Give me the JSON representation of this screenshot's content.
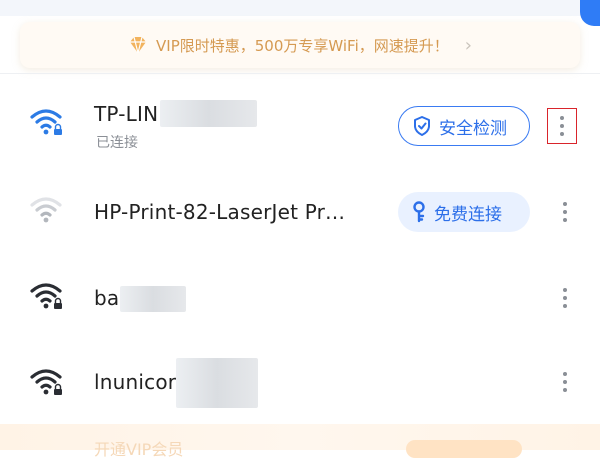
{
  "vip_banner": {
    "text": "VIP限时特惠，500万专享WiFi，网速提升！",
    "gem_icon": "vip-diamond-icon",
    "chevron": "›"
  },
  "colors": {
    "accent": "#2f7cf6",
    "vip_text": "#d59a52",
    "highlight": "#d9242b"
  },
  "networks": [
    {
      "ssid": "TP-LIN",
      "status": "已连接",
      "button_label": "安全检测",
      "button_icon": "shield-check-icon",
      "locked": true,
      "signal": "full",
      "connected": true
    },
    {
      "ssid": "HP-Print-82-LaserJet Pr…",
      "status": "",
      "button_label": "免费连接",
      "button_icon": "key-icon",
      "locked": false,
      "signal": "weak",
      "connected": false
    },
    {
      "ssid": "ba",
      "status": "",
      "button_label": "",
      "locked": true,
      "signal": "full",
      "connected": false
    },
    {
      "ssid": "lnunicor",
      "status": "",
      "button_label": "",
      "locked": true,
      "signal": "full",
      "connected": false
    }
  ],
  "bottom": {
    "text": "开通VIP会员"
  }
}
